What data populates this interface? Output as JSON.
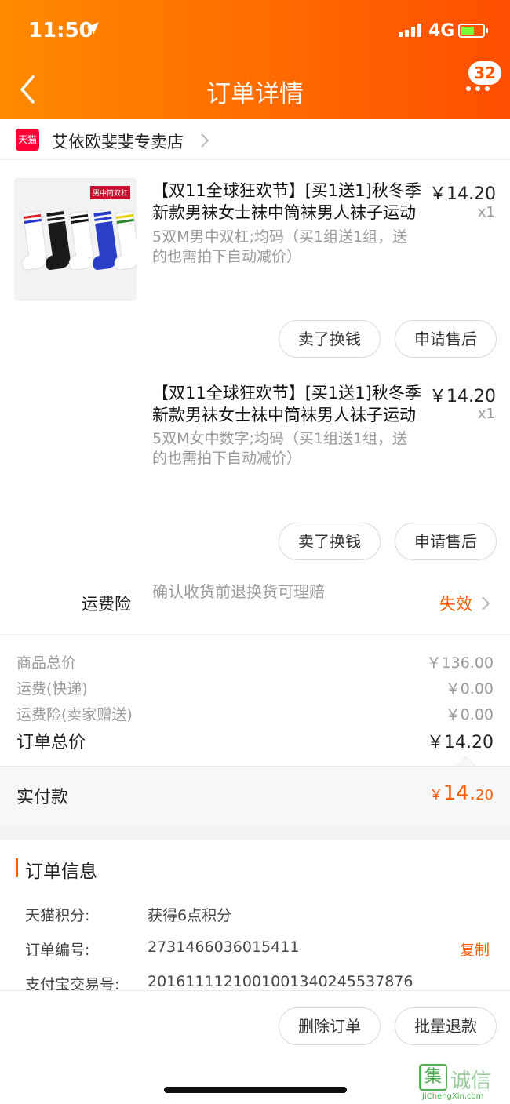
{
  "status_bar": {
    "time": "11:50",
    "network": "4G"
  },
  "header": {
    "title": "订单详情",
    "badge_count": "32"
  },
  "shop": {
    "logo_text": "天猫",
    "name": "艾依欧斐斐专卖店"
  },
  "items": [
    {
      "image_tag": "男中筒双杠",
      "title": "【双11全球狂欢节】[买1送1]秋冬季新款男袜女士袜中筒袜男人袜子运动袜",
      "spec": "5双M男中双杠;均码（买1组送1组，送的也需拍下自动减价）",
      "price": "￥14.20",
      "qty": "x1",
      "btn_resell": "卖了换钱",
      "btn_aftersale": "申请售后"
    },
    {
      "title": "【双11全球狂欢节】[买1送1]秋冬季新款男袜女士袜中筒袜男人袜子运动袜",
      "spec": "5双M女中数字;均码（买1组送1组，送的也需拍下自动减价）",
      "price": "￥14.20",
      "qty": "x1",
      "btn_resell": "卖了换钱",
      "btn_aftersale": "申请售后"
    }
  ],
  "insurance": {
    "label": "运费险",
    "desc": "确认收货前退换货可理赔",
    "status": "失效"
  },
  "summary": {
    "goods_label": "商品总价",
    "goods_value": "￥136.00",
    "shipping_label": "运费(快递)",
    "shipping_value": "￥0.00",
    "ins_label": "运费险(卖家赠送)",
    "ins_value": "￥0.00",
    "total_label": "订单总价",
    "total_value": "￥14.20"
  },
  "paid": {
    "label": "实付款",
    "currency": "￥",
    "int": "14.",
    "dec": "20"
  },
  "order_info": {
    "title": "订单信息",
    "points_label": "天猫积分:",
    "points_value": "获得6点积分",
    "order_no_label": "订单编号:",
    "order_no_value": "2731466036015411",
    "copy_label": "复制",
    "alipay_label": "支付宝交易号:",
    "alipay_value": "2016111121001001340245537876"
  },
  "bottom": {
    "delete_label": "删除订单",
    "refund_label": "批量退款"
  },
  "watermark": {
    "glyph": "集",
    "text": "诚信",
    "url": "JiChengXin.com"
  },
  "colors": {
    "accent": "#ff5a00",
    "header_start": "#ff8a00",
    "header_end": "#ff4e00"
  }
}
